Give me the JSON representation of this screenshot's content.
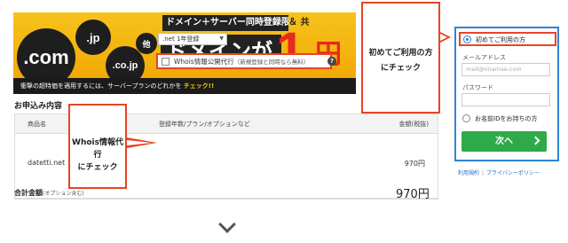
{
  "banner": {
    "com": ".com",
    "jp": ".jp",
    "cojp": ".co.jp",
    "ta": "他",
    "headline": "ドメイン＋サーバー同時登録限定",
    "headline_tail": "＆ 共",
    "big_domain": "ドメインが",
    "one": "1",
    "en": "円",
    "note": "衝撃の超特価を適用するには、サーバープランのどれかを",
    "note_check": "チェック!!"
  },
  "order": {
    "title": "お申込み内容",
    "columns": {
      "product": "商品名",
      "options": "登録年数/プラン/オプションなど",
      "amount": "金額(税抜)"
    },
    "row": {
      "name": "datetti.net",
      "years_select": ".net 1年登録",
      "whois_label": "Whois情報公開代行",
      "whois_sub": "（新規登録と同時なら無料）",
      "price": "970円"
    },
    "total_label": "合計金額",
    "total_sub": "(オプション含む)",
    "total_price": "970円"
  },
  "login": {
    "first_time": "初めてご利用の方",
    "email_label": "メールアドレス",
    "email_placeholder": "mail@onamae.com",
    "password_label": "パスワード",
    "has_id": "お名前IDをお持ちの方",
    "next": "次へ",
    "terms": "利用規約",
    "privacy": "プライバシーポリシー"
  },
  "annotations": {
    "callout1_line1": "初めてご利用の方",
    "callout1_line2": "にチェック",
    "callout2_line1": "Whois情報代行",
    "callout2_line2": "にチェック"
  },
  "colors": {
    "accent_red": "#e64524",
    "button_green": "#2eaa48",
    "login_border": "#2f82d6",
    "banner_yellow": "#f0a400"
  }
}
